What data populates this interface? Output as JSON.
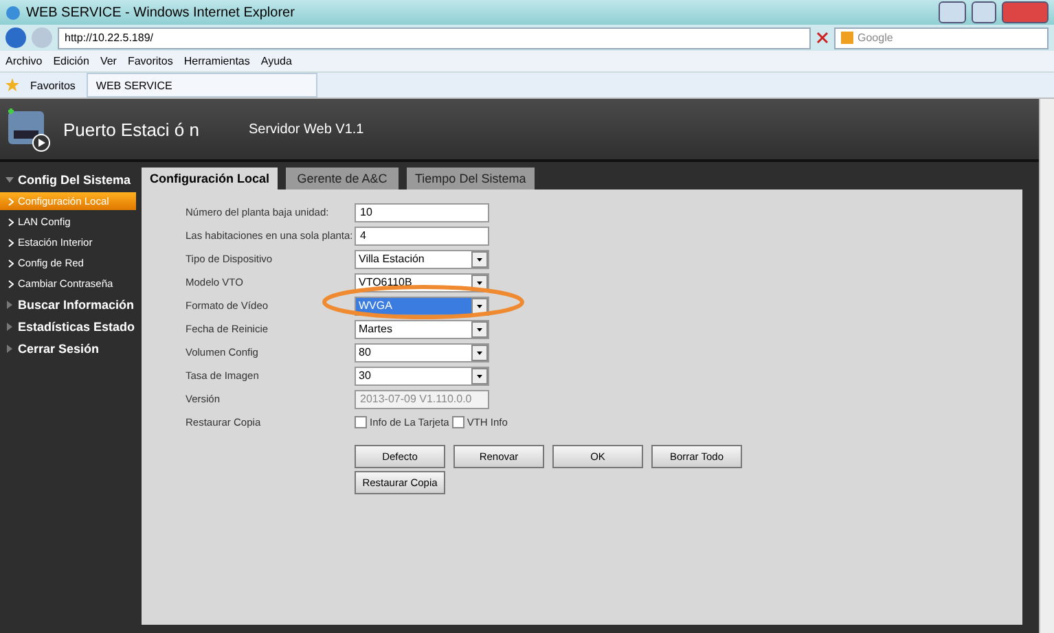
{
  "window": {
    "title": "WEB SERVICE - Windows Internet Explorer"
  },
  "address_bar": {
    "url": "http://10.22.5.189/",
    "search_placeholder": "Google"
  },
  "menu": [
    "Archivo",
    "Edición",
    "Ver",
    "Favoritos",
    "Herramientas",
    "Ayuda"
  ],
  "favorites_bar": {
    "label": "Favoritos",
    "tab": "WEB SERVICE"
  },
  "header": {
    "title": "Puerto Estaci ó n",
    "subtitle": "Servidor Web V1.1"
  },
  "sidebar": [
    {
      "label": "Config Del Sistema",
      "expanded": true,
      "children": [
        {
          "label": "Configuración Local",
          "selected": true
        },
        {
          "label": "LAN Config",
          "selected": false
        },
        {
          "label": "Estación Interior",
          "selected": false
        },
        {
          "label": "Config de Red",
          "selected": false
        },
        {
          "label": "Cambiar Contraseña",
          "selected": false
        }
      ]
    },
    {
      "label": "Buscar Información",
      "expanded": false
    },
    {
      "label": "Estadísticas Estado",
      "expanded": false
    },
    {
      "label": "Cerrar Sesión",
      "expanded": false
    }
  ],
  "tabs": [
    {
      "label": "Configuración Local",
      "selected": true
    },
    {
      "label": "Gerente de A&C",
      "selected": false
    },
    {
      "label": "Tiempo Del Sistema",
      "selected": false
    }
  ],
  "form": [
    {
      "kind": "text",
      "label": "Número del planta baja unidad:",
      "value": "10"
    },
    {
      "kind": "text",
      "label": "Las habitaciones en una sola planta:",
      "value": "4"
    },
    {
      "kind": "select",
      "label": "Tipo de Dispositivo",
      "value": "Villa Estación",
      "highlighted": false
    },
    {
      "kind": "select",
      "label": "Modelo VTO",
      "value": "VTO6110B",
      "highlighted": false
    },
    {
      "kind": "select",
      "label": "Formato de Vídeo",
      "value": "WVGA",
      "highlighted": true,
      "circled": true
    },
    {
      "kind": "select",
      "label": "Fecha de Reinicie",
      "value": "Martes",
      "highlighted": false
    },
    {
      "kind": "select",
      "label": "Volumen Config",
      "value": "80",
      "highlighted": false
    },
    {
      "kind": "select",
      "label": "Tasa de Imagen",
      "value": "30",
      "highlighted": false
    },
    {
      "kind": "disabled",
      "label": "Versión",
      "value": "2013-07-09 V1.110.0.0"
    },
    {
      "kind": "checkboxes",
      "label": "Restaurar Copia",
      "options": [
        {
          "label": "Info de La Tarjeta",
          "checked": false
        },
        {
          "label": "VTH Info",
          "checked": false
        }
      ]
    }
  ],
  "buttons": [
    "Defecto",
    "Renovar",
    "OK",
    "Borrar Todo"
  ],
  "second_buttons": [
    "Restaurar Copia"
  ]
}
